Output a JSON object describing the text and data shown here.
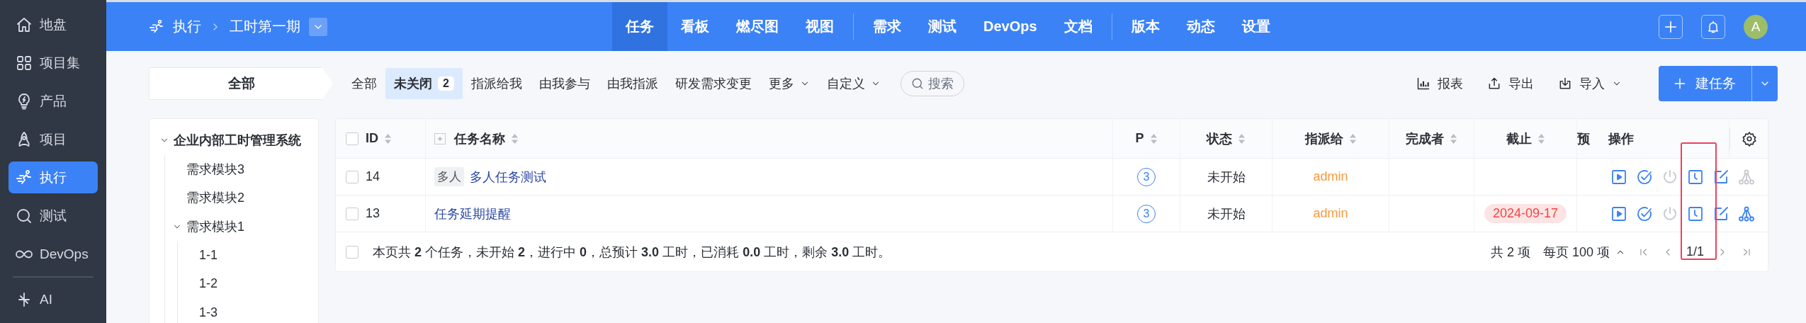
{
  "sidebar": {
    "items": [
      {
        "label": "地盘",
        "kind": "home",
        "selected": false
      },
      {
        "label": "项目集",
        "kind": "grid",
        "selected": false
      },
      {
        "label": "产品",
        "kind": "bulb",
        "selected": false
      },
      {
        "label": "项目",
        "kind": "rocket",
        "selected": false
      },
      {
        "label": "执行",
        "kind": "run",
        "selected": true
      },
      {
        "label": "测试",
        "kind": "search",
        "selected": false
      },
      {
        "label": "DevOps",
        "kind": "infinity",
        "selected": false
      }
    ],
    "bottom_items": [
      {
        "label": "AI",
        "kind": "spark",
        "selected": false
      }
    ]
  },
  "topbar": {
    "breadcrumb": [
      "执行",
      "工时第一期"
    ],
    "nav_groups": [
      [
        {
          "label": "任务",
          "selected": true
        },
        {
          "label": "看板",
          "selected": false
        },
        {
          "label": "燃尽图",
          "selected": false
        },
        {
          "label": "视图",
          "selected": false
        }
      ],
      [
        {
          "label": "需求",
          "selected": false
        },
        {
          "label": "测试",
          "selected": false
        },
        {
          "label": "DevOps",
          "selected": false
        },
        {
          "label": "文档",
          "selected": false
        }
      ],
      [
        {
          "label": "版本",
          "selected": false
        },
        {
          "label": "动态",
          "selected": false
        },
        {
          "label": "设置",
          "selected": false
        }
      ]
    ],
    "avatar": "A"
  },
  "filters": {
    "side_tab": "全部",
    "items": [
      {
        "label": "全部",
        "selected": false,
        "dropdown": false
      },
      {
        "label": "未关闭",
        "count": "2",
        "selected": true,
        "dropdown": false
      },
      {
        "label": "指派给我",
        "selected": false,
        "dropdown": false
      },
      {
        "label": "由我参与",
        "selected": false,
        "dropdown": false
      },
      {
        "label": "由我指派",
        "selected": false,
        "dropdown": false
      },
      {
        "label": "研发需求变更",
        "selected": false,
        "dropdown": false
      },
      {
        "label": "更多",
        "selected": false,
        "dropdown": true
      },
      {
        "label": "自定义",
        "selected": false,
        "dropdown": true
      }
    ],
    "search": {
      "placeholder": "搜索"
    },
    "actions": [
      {
        "label": "报表",
        "kind": "chart",
        "dropdown": false
      },
      {
        "label": "导出",
        "kind": "export",
        "dropdown": false
      },
      {
        "label": "导入",
        "kind": "import",
        "dropdown": true
      }
    ],
    "create_button": "建任务"
  },
  "tree": [
    {
      "label": "企业内部工时管理系统",
      "expanded": true,
      "children": [
        {
          "label": "需求模块3"
        },
        {
          "label": "需求模块2"
        },
        {
          "label": "需求模块1",
          "expanded": true,
          "children": [
            {
              "label": "1-1"
            },
            {
              "label": "1-2"
            },
            {
              "label": "1-3"
            }
          ]
        }
      ]
    }
  ],
  "table": {
    "header_checkbox": {
      "checked": false
    },
    "columns": [
      {
        "label": "ID",
        "sortable": true
      },
      {
        "label": "任务名称",
        "sortable": true
      },
      {
        "label": "P",
        "sortable": true
      },
      {
        "label": "状态",
        "sortable": true
      },
      {
        "label": "指派给",
        "sortable": true
      },
      {
        "label": "完成者",
        "sortable": true
      },
      {
        "label": "截止",
        "sortable": true
      },
      {
        "label": "预",
        "sortable": false
      },
      {
        "label": "操作",
        "sortable": false
      }
    ],
    "rows": [
      {
        "checked": false,
        "id": "14",
        "tag": "多人",
        "name": "多人任务测试",
        "priority": "3",
        "status": "未开始",
        "assigned_to": "admin",
        "actions": [
          {
            "kind": "start",
            "disabled": false
          },
          {
            "kind": "finish",
            "disabled": false
          },
          {
            "kind": "close",
            "disabled": true
          },
          {
            "kind": "record",
            "disabled": false
          },
          {
            "kind": "edit",
            "disabled": false
          },
          {
            "kind": "split",
            "disabled": true
          }
        ]
      },
      {
        "checked": false,
        "id": "13",
        "name": "任务延期提醒",
        "priority": "3",
        "status": "未开始",
        "assigned_to": "admin",
        "deadline": "2024-09-17",
        "deadline_overdue": true,
        "actions": [
          {
            "kind": "start",
            "disabled": false
          },
          {
            "kind": "finish",
            "disabled": false
          },
          {
            "kind": "close",
            "disabled": true
          },
          {
            "kind": "record",
            "disabled": false
          },
          {
            "kind": "edit",
            "disabled": false
          },
          {
            "kind": "split",
            "disabled": false
          }
        ]
      }
    ],
    "footer_checkbox": {
      "checked": false
    },
    "summary": "本页共 **2** 个任务，未开始 **2**，进行中 **0**，总预计 **3.0** 工时，已消耗 **0.0** 工时，剩余 **3.0** 工时。",
    "pagination": {
      "total": "共 2 项",
      "page_size": "每页 100 项",
      "page": "1/1"
    }
  }
}
